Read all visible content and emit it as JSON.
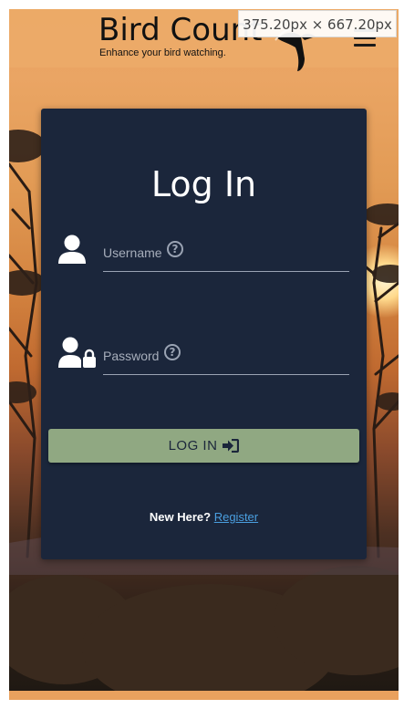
{
  "devtools": {
    "dimensions": "375.20px × 667.20px"
  },
  "header": {
    "title": "Bird Count",
    "tagline": "Enhance your bird watching.",
    "menu_icon": "hamburger-icon"
  },
  "login": {
    "title": "Log In",
    "username": {
      "label": "Username",
      "value": "",
      "icon": "user-icon",
      "help_icon": "question-circle-icon"
    },
    "password": {
      "label": "Password",
      "value": "",
      "icon": "user-lock-icon",
      "help_icon": "question-circle-icon"
    },
    "submit_label": "LOG IN",
    "submit_icon": "sign-in-icon",
    "register_prompt": "New Here?",
    "register_link": "Register"
  },
  "colors": {
    "card": "#1b263b",
    "button": "#90a882",
    "link": "#4a9fe0",
    "header": "#eaa664"
  }
}
